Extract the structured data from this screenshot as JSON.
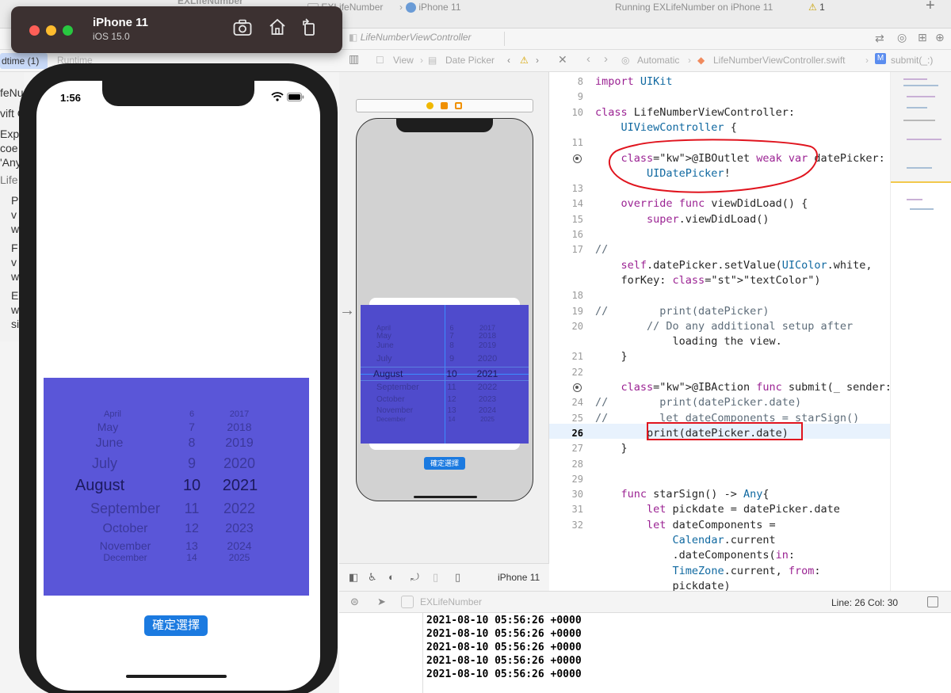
{
  "simulator": {
    "device_name": "iPhone 11",
    "os_version": "iOS 15.0",
    "status_time": "1:56",
    "confirm_button": "確定選擇",
    "picker": {
      "months": [
        "April",
        "May",
        "June",
        "July",
        "August",
        "September",
        "October",
        "November",
        "December"
      ],
      "days": [
        "6",
        "7",
        "8",
        "9",
        "10",
        "11",
        "12",
        "13",
        "14"
      ],
      "years": [
        "2017",
        "2018",
        "2019",
        "2020",
        "2021",
        "2022",
        "2023",
        "2024",
        "2025"
      ],
      "selected": {
        "month": "August",
        "day": "10",
        "year": "2021"
      }
    },
    "picker_color": "#5a56d8",
    "button_color": "#1b7ae0"
  },
  "toolbar": {
    "project_title": "EXLifeNumber",
    "scheme_crumb": "EXLifeNumber",
    "destination": "iPhone 11",
    "status": "Running EXLifeNumber on iPhone 11",
    "warning_count": "1"
  },
  "tabs": {
    "left_tab_1": "dtime (1)",
    "left_tab_2": "Runtime",
    "ib_file": "LifeNumberViewController"
  },
  "navigator": {
    "lines": [
      "feNu",
      "vift C",
      "Expl",
      "coe",
      "'Any",
      "Life",
      "P",
      "v",
      "w",
      "F",
      "v",
      "w",
      "EX",
      "w",
      "si"
    ]
  },
  "ib": {
    "breadcrumb": [
      "View",
      "Date Picker"
    ],
    "device_label": "iPhone 11",
    "confirm_button": "確定選擇",
    "picker": {
      "months": [
        "April",
        "May",
        "June",
        "July",
        "August",
        "September",
        "October",
        "November",
        "December"
      ],
      "days": [
        "6",
        "7",
        "8",
        "9",
        "10",
        "11",
        "12",
        "13",
        "14"
      ],
      "years": [
        "2017",
        "2018",
        "2019",
        "2020",
        "2021",
        "2022",
        "2023",
        "2024",
        "2025"
      ]
    }
  },
  "editor": {
    "breadcrumb": [
      "Automatic",
      "LifeNumberViewController.swift",
      "submit(_:)"
    ],
    "current_line": "26",
    "status": "Line: 26  Col: 30",
    "lines": [
      {
        "n": "8",
        "code": "import UIKit"
      },
      {
        "n": "9",
        "code": ""
      },
      {
        "n": "10",
        "code": "class LifeNumberViewController:"
      },
      {
        "n": "",
        "code": "    UIViewController {"
      },
      {
        "n": "11",
        "code": ""
      },
      {
        "n": "",
        "code": "    @IBOutlet weak var datePicker:"
      },
      {
        "n": "",
        "code": "        UIDatePicker!"
      },
      {
        "n": "13",
        "code": ""
      },
      {
        "n": "14",
        "code": "    override func viewDidLoad() {"
      },
      {
        "n": "15",
        "code": "        super.viewDidLoad()"
      },
      {
        "n": "16",
        "code": ""
      },
      {
        "n": "17",
        "code": "//"
      },
      {
        "n": "",
        "code": "    self.datePicker.setValue(UIColor.white,"
      },
      {
        "n": "",
        "code": "    forKey: \"textColor\")"
      },
      {
        "n": "18",
        "code": ""
      },
      {
        "n": "19",
        "code": "//        print(datePicker)"
      },
      {
        "n": "20",
        "code": "        // Do any additional setup after"
      },
      {
        "n": "",
        "code": "            loading the view."
      },
      {
        "n": "21",
        "code": "    }"
      },
      {
        "n": "22",
        "code": ""
      },
      {
        "n": "",
        "code": "    @IBAction func submit(_ sender: Any) {"
      },
      {
        "n": "24",
        "code": "//        print(datePicker.date)"
      },
      {
        "n": "25",
        "code": "//        let dateComponents = starSign()"
      },
      {
        "n": "26",
        "code": "        print(datePicker.date)"
      },
      {
        "n": "27",
        "code": "    }"
      },
      {
        "n": "28",
        "code": ""
      },
      {
        "n": "29",
        "code": ""
      },
      {
        "n": "30",
        "code": "    func starSign() -> Any{"
      },
      {
        "n": "31",
        "code": "        let pickdate = datePicker.date"
      },
      {
        "n": "32",
        "code": "        let dateComponents ="
      },
      {
        "n": "",
        "code": "            Calendar.current"
      },
      {
        "n": "",
        "code": "            .dateComponents(in:"
      },
      {
        "n": "",
        "code": "            TimeZone.current, from:"
      },
      {
        "n": "",
        "code": "            pickdate)"
      }
    ]
  },
  "debug": {
    "scheme": "EXLifeNumber",
    "console": [
      "2021-08-10 05:56:26 +0000",
      "2021-08-10 05:56:26 +0000",
      "2021-08-10 05:56:26 +0000",
      "2021-08-10 05:56:26 +0000",
      "2021-08-10 05:56:26 +0000"
    ]
  },
  "colors": {
    "annotation_red": "#e0141e",
    "keyword": "#9b2393",
    "type": "#0f68a0",
    "comment": "#5d6c79"
  }
}
